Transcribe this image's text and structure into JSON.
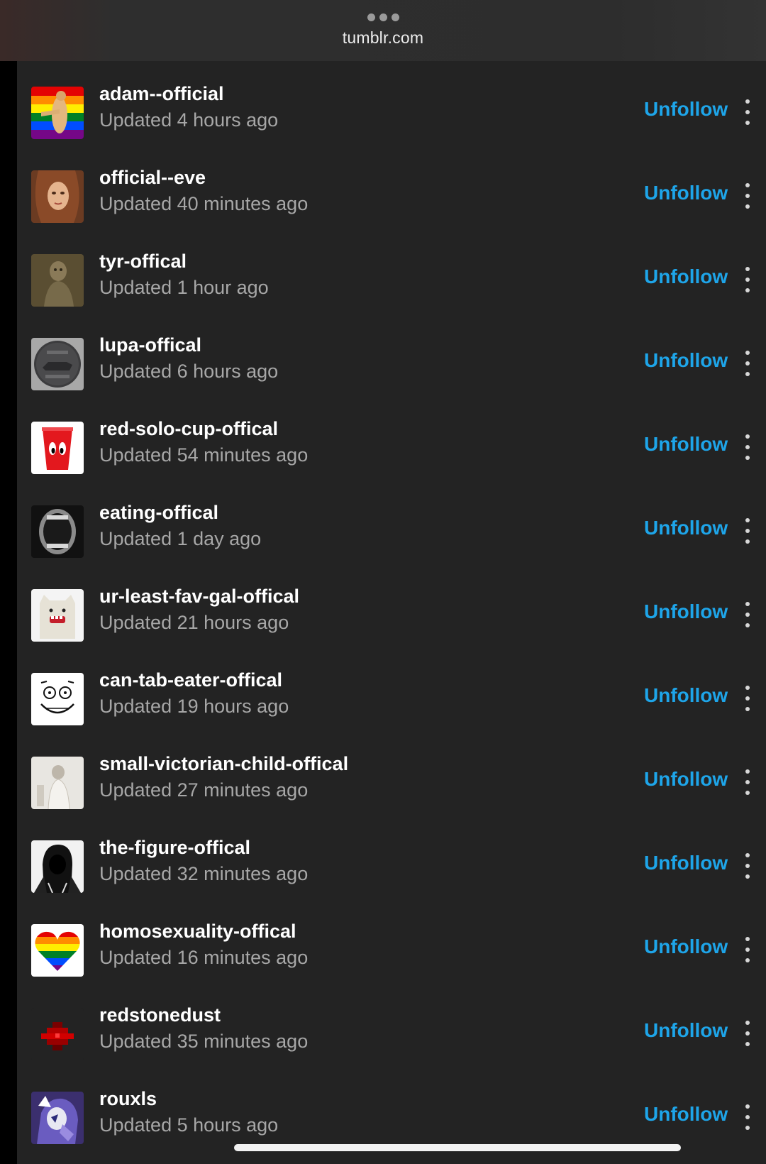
{
  "browser": {
    "url": "tumblr.com"
  },
  "colors": {
    "accent": "#1ea5e9",
    "panel": "#232323",
    "text_primary": "#ffffff",
    "text_secondary": "#a7a7a7"
  },
  "following": [
    {
      "name": "adam--official",
      "updated": "Updated 4 hours ago",
      "action": "Unfollow",
      "avatar": "rainbow-flag-adam"
    },
    {
      "name": "official--eve",
      "updated": "Updated 40 minutes ago",
      "action": "Unfollow",
      "avatar": "painted-woman"
    },
    {
      "name": "tyr-offical",
      "updated": "Updated 1 hour ago",
      "action": "Unfollow",
      "avatar": "stone-statue"
    },
    {
      "name": "lupa-offical",
      "updated": "Updated 6 hours ago",
      "action": "Unfollow",
      "avatar": "roman-coin-wolf"
    },
    {
      "name": "red-solo-cup-offical",
      "updated": "Updated 54 minutes ago",
      "action": "Unfollow",
      "avatar": "red-cup-eyes"
    },
    {
      "name": "eating-offical",
      "updated": "Updated 1 day ago",
      "action": "Unfollow",
      "avatar": "open-mouth"
    },
    {
      "name": "ur-least-fav-gal-offical",
      "updated": "Updated 21 hours ago",
      "action": "Unfollow",
      "avatar": "plush-monster"
    },
    {
      "name": "can-tab-eater-offical",
      "updated": "Updated 19 hours ago",
      "action": "Unfollow",
      "avatar": "grinning-face-sketch"
    },
    {
      "name": "small-victorian-child-offical",
      "updated": "Updated 27 minutes ago",
      "action": "Unfollow",
      "avatar": "victorian-child-photo"
    },
    {
      "name": "the-figure-offical",
      "updated": "Updated 32 minutes ago",
      "action": "Unfollow",
      "avatar": "hooded-figure"
    },
    {
      "name": "homosexuality-offical",
      "updated": "Updated 16 minutes ago",
      "action": "Unfollow",
      "avatar": "rainbow-heart"
    },
    {
      "name": "redstonedust",
      "updated": "Updated 35 minutes ago",
      "action": "Unfollow",
      "avatar": "redstone-dust"
    },
    {
      "name": "rouxls",
      "updated": "Updated 5 hours ago",
      "action": "Unfollow",
      "avatar": "purple-character"
    }
  ]
}
